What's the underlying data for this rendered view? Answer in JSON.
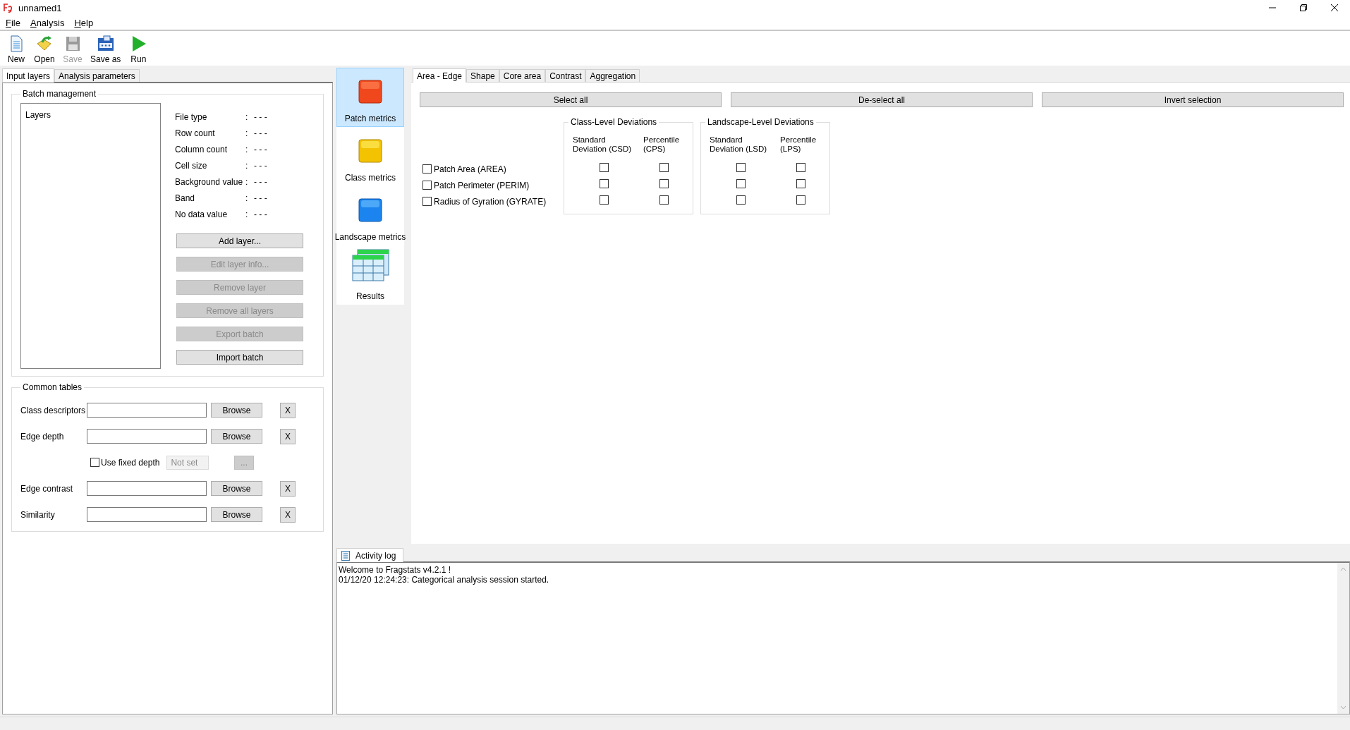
{
  "window": {
    "title": "unnamed1"
  },
  "menu": [
    "File",
    "Analysis",
    "Help"
  ],
  "toolbar": [
    {
      "label": "New",
      "disabled": false
    },
    {
      "label": "Open",
      "disabled": false
    },
    {
      "label": "Save",
      "disabled": true
    },
    {
      "label": "Save as",
      "disabled": false
    },
    {
      "label": "Run",
      "disabled": false
    }
  ],
  "left_tabs": [
    {
      "label": "Input layers",
      "selected": true
    },
    {
      "label": "Analysis parameters",
      "selected": false
    }
  ],
  "batch_management": {
    "title": "Batch management",
    "list_header": "Layers",
    "info": [
      {
        "label": "File type",
        "separator": ":",
        "value": "- - -"
      },
      {
        "label": "Row count",
        "separator": ":",
        "value": "- - -"
      },
      {
        "label": "Column count",
        "separator": ":",
        "value": "- - -"
      },
      {
        "label": "Cell size",
        "separator": ":",
        "value": "- - -"
      },
      {
        "label": "Background value",
        "separator": ":",
        "value": "- - -"
      },
      {
        "label": "Band",
        "separator": ":",
        "value": "- - -"
      },
      {
        "label": "No data value",
        "separator": ":",
        "value": "- - -"
      }
    ],
    "buttons": [
      {
        "label": "Add layer...",
        "disabled": false
      },
      {
        "label": "Edit layer info...",
        "disabled": true
      },
      {
        "label": "Remove layer",
        "disabled": true
      },
      {
        "label": "Remove all layers",
        "disabled": true
      },
      {
        "label": "Export batch",
        "disabled": true
      },
      {
        "label": "Import batch",
        "disabled": false
      }
    ]
  },
  "common_tables": {
    "title": "Common tables",
    "rows": [
      {
        "kind": "file",
        "label": "Class descriptors",
        "button": "Browse",
        "clear": "X"
      },
      {
        "kind": "file",
        "label": "Edge depth",
        "button": "Browse",
        "clear": "X"
      },
      {
        "kind": "option",
        "label": "Use fixed depth",
        "checked": false,
        "placeholder": "Not set",
        "button": "..."
      },
      {
        "kind": "file",
        "label": "Edge contrast",
        "button": "Browse",
        "clear": "X"
      },
      {
        "kind": "file",
        "label": "Similarity",
        "button": "Browse",
        "clear": "X"
      }
    ]
  },
  "nav": [
    {
      "label": "Patch metrics",
      "selected": true
    },
    {
      "label": "Class metrics",
      "selected": false
    },
    {
      "label": "Landscape metrics",
      "selected": false
    },
    {
      "label": "Results",
      "selected": false
    }
  ],
  "metric_tabs": [
    {
      "label": "Area - Edge",
      "selected": true
    },
    {
      "label": "Shape",
      "selected": false
    },
    {
      "label": "Core area",
      "selected": false
    },
    {
      "label": "Contrast",
      "selected": false
    },
    {
      "label": "Aggregation",
      "selected": false
    }
  ],
  "actions": [
    "Select all",
    "De-select all",
    "Invert selection"
  ],
  "metrics": [
    {
      "label": "Patch Area  (AREA)",
      "checked": false
    },
    {
      "label": "Patch Perimeter  (PERIM)",
      "checked": false
    },
    {
      "label": "Radius of Gyration  (GYRATE)",
      "checked": false
    }
  ],
  "deviation_groups": [
    {
      "title": "Class-Level Deviations",
      "columns": [
        "Standard\nDeviation  (CSD)",
        "Percentile\n(CPS)"
      ],
      "rows": [
        {
          "checks": [
            false,
            false
          ]
        },
        {
          "checks": [
            false,
            false
          ]
        },
        {
          "checks": [
            false,
            false
          ]
        }
      ]
    },
    {
      "title": "Landscape-Level Deviations",
      "columns": [
        "Standard\nDeviation  (LSD)",
        "Percentile\n(LPS)"
      ],
      "rows": [
        {
          "checks": [
            false,
            false
          ]
        },
        {
          "checks": [
            false,
            false
          ]
        },
        {
          "checks": [
            false,
            false
          ]
        }
      ]
    }
  ],
  "activity_log": {
    "tab": "Activity log",
    "lines": [
      "Welcome to Fragstats v4.2.1 !",
      "01/12/20 12:24:23: Categorical analysis session started."
    ]
  }
}
